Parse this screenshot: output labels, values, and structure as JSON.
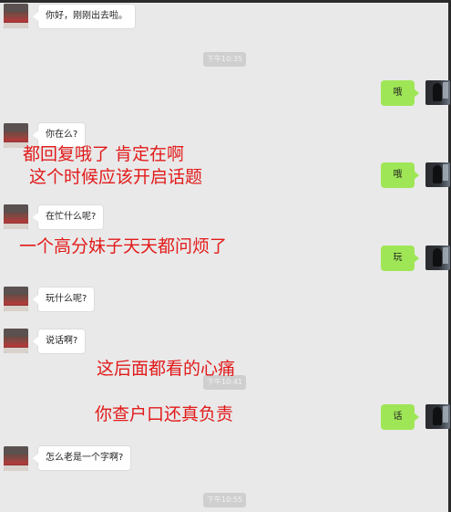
{
  "messages": [
    {
      "side": "left",
      "text": "你好，刚刚出去啦。"
    },
    {
      "side": "system",
      "text": "下午10:35"
    },
    {
      "side": "right",
      "text": "哦"
    },
    {
      "side": "left",
      "text": "你在么?"
    },
    {
      "side": "right",
      "text": "哦"
    },
    {
      "side": "left",
      "text": "在忙什么呢?"
    },
    {
      "side": "right",
      "text": "玩"
    },
    {
      "side": "left",
      "text": "玩什么呢?"
    },
    {
      "side": "left",
      "text": "说话啊?"
    },
    {
      "side": "system",
      "text": "下午10:41"
    },
    {
      "side": "right",
      "text": "话"
    },
    {
      "side": "left",
      "text": "怎么老是一个字啊?"
    },
    {
      "side": "system",
      "text": "下午10:55"
    }
  ],
  "annotations": [
    "都回复哦了 肯定在啊",
    "这个时候应该开启话题",
    "一个高分妹子天天都问烦了",
    "这后面都看的心痛",
    "你查户口还真负责"
  ],
  "colors": {
    "background": "#e9e9e9",
    "outgoing_bubble": "#9fe656",
    "incoming_bubble": "#ffffff",
    "annotation_text": "#e21a1a"
  },
  "icons": {
    "contact_avatar": "contact-avatar-icon",
    "self_avatar": "self-avatar-icon"
  }
}
